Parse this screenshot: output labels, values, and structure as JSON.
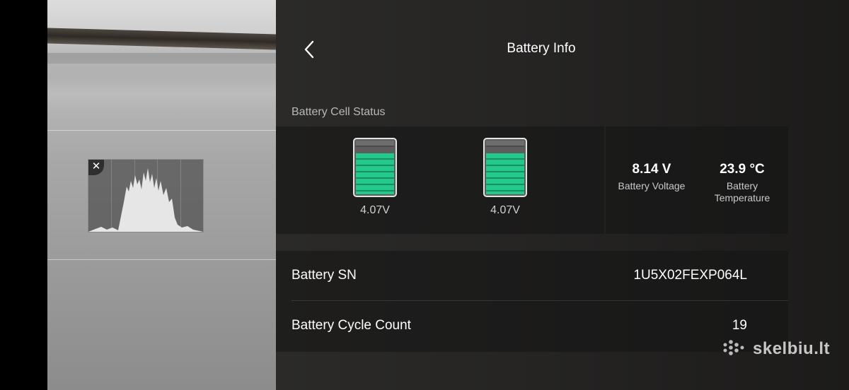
{
  "header": {
    "title": "Battery Info"
  },
  "cell_status": {
    "label": "Battery Cell Status",
    "cells": [
      {
        "voltage": "4.07V",
        "level": 0.87
      },
      {
        "voltage": "4.07V",
        "level": 0.87
      }
    ],
    "fill_color": "#22c98a"
  },
  "stats": {
    "voltage": {
      "value": "8.14 V",
      "label": "Battery Voltage"
    },
    "temperature": {
      "value": "23.9 °C",
      "label_line1": "Battery",
      "label_line2": "Temperature"
    }
  },
  "info": {
    "sn": {
      "label": "Battery SN",
      "value": "1U5X02FEXP064L"
    },
    "cycles": {
      "label": "Battery Cycle Count",
      "value": "19"
    }
  },
  "histogram": {
    "close_glyph": "✕"
  },
  "watermark": {
    "text": "skelbiu.lt"
  }
}
